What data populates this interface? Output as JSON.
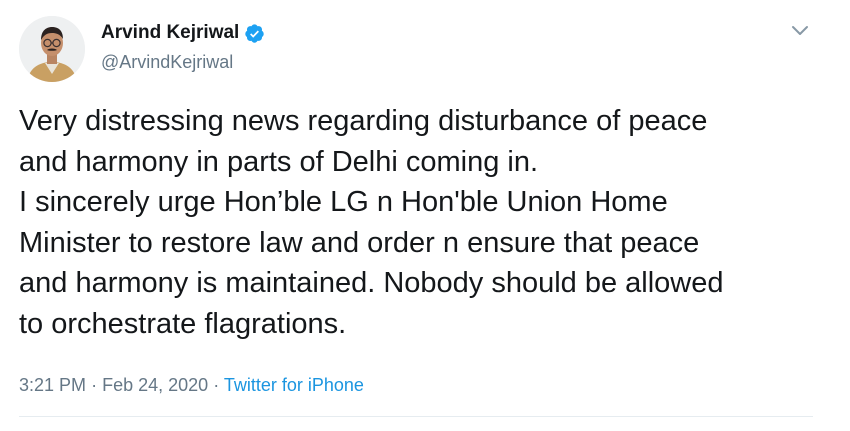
{
  "author": {
    "display_name": "Arvind Kejriwal",
    "handle": "@ArvindKejriwal",
    "verified": true,
    "avatar_icon": "person-avatar"
  },
  "tweet": {
    "text": "Very distressing news regarding disturbance of peace\nand harmony in parts of Delhi coming in.\nI sincerely urge Hon’ble LG n Hon'ble Union Home\nMinister to restore law and order n ensure that peace\nand harmony is maintained. Nobody should be allowed\nto orchestrate flagrations.",
    "time": "3:21 PM",
    "separator1": "·",
    "date": "Feb 24, 2020",
    "separator2": "·",
    "source": "Twitter for iPhone"
  },
  "icons": {
    "verified": "verified-badge-icon",
    "more": "chevron-down-icon"
  },
  "colors": {
    "verified_blue": "#1da1f2",
    "link_blue": "#1b95e0",
    "secondary_text": "#657786",
    "primary_text": "#14171a"
  }
}
